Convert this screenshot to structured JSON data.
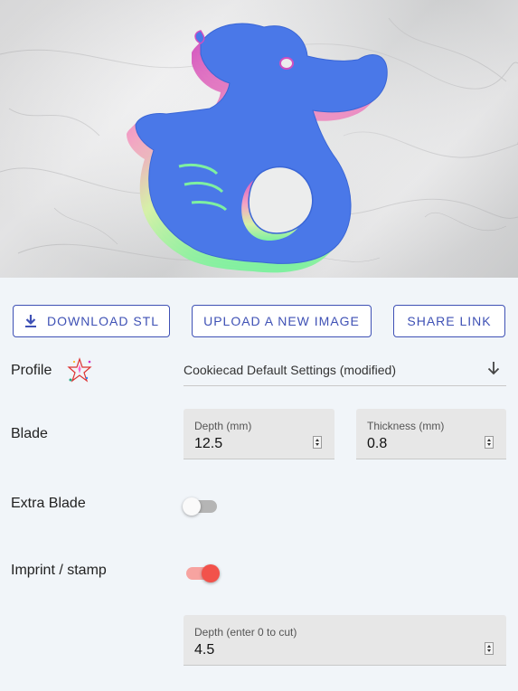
{
  "toolbar": {
    "download_label": "DOWNLOAD STL",
    "upload_label": "UPLOAD A NEW IMAGE",
    "share_label": "SHARE LINK"
  },
  "profile": {
    "label": "Profile",
    "value": "Cookiecad Default Settings (modified)"
  },
  "blade": {
    "label": "Blade",
    "depth_label": "Depth (mm)",
    "depth_value": "12.5",
    "thickness_label": "Thickness (mm)",
    "thickness_value": "0.8"
  },
  "extra_blade": {
    "label": "Extra Blade",
    "enabled": false
  },
  "imprint": {
    "label": "Imprint / stamp",
    "enabled": true,
    "depth_label": "Depth (enter 0 to cut)",
    "depth_value": "4.5"
  },
  "colors": {
    "accent": "#3f51b5",
    "toggle_on": "#f2524b",
    "duck_blue": "#4a78e8"
  }
}
